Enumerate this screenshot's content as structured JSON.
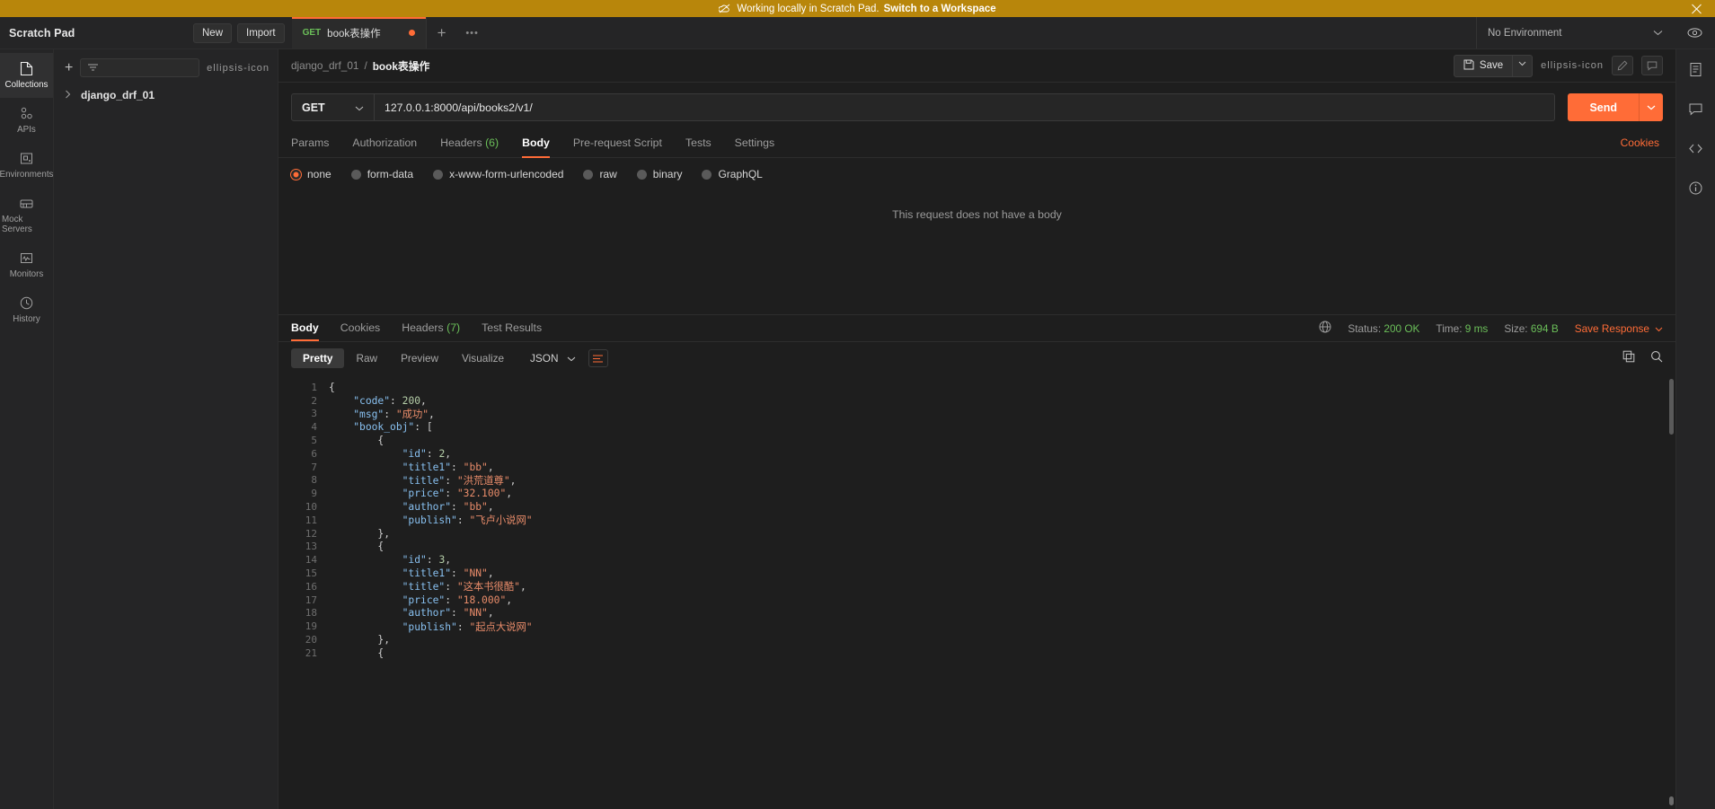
{
  "banner": {
    "icon": "cloud-off-icon",
    "text": "Working locally in Scratch Pad.",
    "link": "Switch to a Workspace",
    "close": "close-icon",
    "bg_color": "#b8860b"
  },
  "header": {
    "brand": "Scratch Pad",
    "new_button": "New",
    "import_button": "Import",
    "tabs": [
      {
        "method": "GET",
        "name": "book表操作",
        "unsaved": true
      }
    ],
    "add_tab": "+",
    "tab_more": "•••",
    "environment": "No Environment",
    "eye_icon": "eye-icon"
  },
  "rail": {
    "items": [
      {
        "label": "Collections",
        "icon": "collections-icon",
        "active": true
      },
      {
        "label": "APIs",
        "icon": "apis-icon",
        "active": false
      },
      {
        "label": "Environments",
        "icon": "environments-icon",
        "active": false
      },
      {
        "label": "Mock Servers",
        "icon": "mock-servers-icon",
        "active": false
      },
      {
        "label": "Monitors",
        "icon": "monitors-icon",
        "active": false
      },
      {
        "label": "History",
        "icon": "history-icon",
        "active": false
      }
    ]
  },
  "sidebar": {
    "add_icon": "plus-icon",
    "filter_icon": "filter-icon",
    "filter_placeholder": "",
    "more_icon": "ellipsis-icon",
    "collections": [
      {
        "name": "django_drf_01",
        "expanded": false
      }
    ]
  },
  "request": {
    "breadcrumb_collection": "django_drf_01",
    "breadcrumb_sep": "/",
    "breadcrumb_current": "book表操作",
    "save_label": "Save",
    "save_caret": "⌄",
    "more_icon": "ellipsis-icon",
    "method": "GET",
    "url": "127.0.0.1:8000/api/books2/v1/",
    "send_label": "Send",
    "tabs": [
      {
        "label": "Params",
        "count": "",
        "active": false
      },
      {
        "label": "Authorization",
        "count": "",
        "active": false
      },
      {
        "label": "Headers",
        "count": "(6)",
        "active": false
      },
      {
        "label": "Body",
        "count": "",
        "active": true
      },
      {
        "label": "Pre-request Script",
        "count": "",
        "active": false
      },
      {
        "label": "Tests",
        "count": "",
        "active": false
      },
      {
        "label": "Settings",
        "count": "",
        "active": false
      }
    ],
    "cookies_link": "Cookies",
    "body_types": [
      {
        "label": "none",
        "selected": true
      },
      {
        "label": "form-data",
        "selected": false
      },
      {
        "label": "x-www-form-urlencoded",
        "selected": false
      },
      {
        "label": "raw",
        "selected": false
      },
      {
        "label": "binary",
        "selected": false
      },
      {
        "label": "GraphQL",
        "selected": false
      }
    ],
    "empty_body_text": "This request does not have a body"
  },
  "response": {
    "tabs": [
      {
        "label": "Body",
        "count": "",
        "active": true
      },
      {
        "label": "Cookies",
        "count": "",
        "active": false
      },
      {
        "label": "Headers",
        "count": "(7)",
        "active": false
      },
      {
        "label": "Test Results",
        "count": "",
        "active": false
      }
    ],
    "globe_icon": "globe-icon",
    "status_label": "Status:",
    "status_value": "200 OK",
    "time_label": "Time:",
    "time_value": "9 ms",
    "size_label": "Size:",
    "size_value": "694 B",
    "save_response": "Save Response",
    "save_response_caret": "⌄",
    "view_modes": [
      {
        "label": "Pretty",
        "active": true
      },
      {
        "label": "Raw",
        "active": false
      },
      {
        "label": "Preview",
        "active": false
      },
      {
        "label": "Visualize",
        "active": false
      }
    ],
    "format": "JSON",
    "format_caret": "⌄",
    "wrap_icon": "wrap-lines-icon",
    "copy_icon": "copy-icon",
    "search_icon": "search-icon",
    "body_lines": [
      {
        "n": 1,
        "tokens": [
          {
            "t": "p",
            "v": "{"
          }
        ]
      },
      {
        "n": 2,
        "tokens": [
          {
            "t": "p",
            "v": "    "
          },
          {
            "t": "k",
            "v": "\"code\""
          },
          {
            "t": "p",
            "v": ": "
          },
          {
            "t": "n",
            "v": "200"
          },
          {
            "t": "p",
            "v": ","
          }
        ]
      },
      {
        "n": 3,
        "tokens": [
          {
            "t": "p",
            "v": "    "
          },
          {
            "t": "k",
            "v": "\"msg\""
          },
          {
            "t": "p",
            "v": ": "
          },
          {
            "t": "s",
            "v": "\"成功\""
          },
          {
            "t": "p",
            "v": ","
          }
        ]
      },
      {
        "n": 4,
        "tokens": [
          {
            "t": "p",
            "v": "    "
          },
          {
            "t": "k",
            "v": "\"book_obj\""
          },
          {
            "t": "p",
            "v": ": ["
          }
        ]
      },
      {
        "n": 5,
        "tokens": [
          {
            "t": "p",
            "v": "        {"
          }
        ]
      },
      {
        "n": 6,
        "tokens": [
          {
            "t": "p",
            "v": "            "
          },
          {
            "t": "k",
            "v": "\"id\""
          },
          {
            "t": "p",
            "v": ": "
          },
          {
            "t": "n",
            "v": "2"
          },
          {
            "t": "p",
            "v": ","
          }
        ]
      },
      {
        "n": 7,
        "tokens": [
          {
            "t": "p",
            "v": "            "
          },
          {
            "t": "k",
            "v": "\"title1\""
          },
          {
            "t": "p",
            "v": ": "
          },
          {
            "t": "s",
            "v": "\"bb\""
          },
          {
            "t": "p",
            "v": ","
          }
        ]
      },
      {
        "n": 8,
        "tokens": [
          {
            "t": "p",
            "v": "            "
          },
          {
            "t": "k",
            "v": "\"title\""
          },
          {
            "t": "p",
            "v": ": "
          },
          {
            "t": "s",
            "v": "\"洪荒道尊\""
          },
          {
            "t": "p",
            "v": ","
          }
        ]
      },
      {
        "n": 9,
        "tokens": [
          {
            "t": "p",
            "v": "            "
          },
          {
            "t": "k",
            "v": "\"price\""
          },
          {
            "t": "p",
            "v": ": "
          },
          {
            "t": "s",
            "v": "\"32.100\""
          },
          {
            "t": "p",
            "v": ","
          }
        ]
      },
      {
        "n": 10,
        "tokens": [
          {
            "t": "p",
            "v": "            "
          },
          {
            "t": "k",
            "v": "\"author\""
          },
          {
            "t": "p",
            "v": ": "
          },
          {
            "t": "s",
            "v": "\"bb\""
          },
          {
            "t": "p",
            "v": ","
          }
        ]
      },
      {
        "n": 11,
        "tokens": [
          {
            "t": "p",
            "v": "            "
          },
          {
            "t": "k",
            "v": "\"publish\""
          },
          {
            "t": "p",
            "v": ": "
          },
          {
            "t": "s",
            "v": "\"飞卢小说网\""
          }
        ]
      },
      {
        "n": 12,
        "tokens": [
          {
            "t": "p",
            "v": "        },"
          }
        ]
      },
      {
        "n": 13,
        "tokens": [
          {
            "t": "p",
            "v": "        {"
          }
        ]
      },
      {
        "n": 14,
        "tokens": [
          {
            "t": "p",
            "v": "            "
          },
          {
            "t": "k",
            "v": "\"id\""
          },
          {
            "t": "p",
            "v": ": "
          },
          {
            "t": "n",
            "v": "3"
          },
          {
            "t": "p",
            "v": ","
          }
        ]
      },
      {
        "n": 15,
        "tokens": [
          {
            "t": "p",
            "v": "            "
          },
          {
            "t": "k",
            "v": "\"title1\""
          },
          {
            "t": "p",
            "v": ": "
          },
          {
            "t": "s",
            "v": "\"NN\""
          },
          {
            "t": "p",
            "v": ","
          }
        ]
      },
      {
        "n": 16,
        "tokens": [
          {
            "t": "p",
            "v": "            "
          },
          {
            "t": "k",
            "v": "\"title\""
          },
          {
            "t": "p",
            "v": ": "
          },
          {
            "t": "s",
            "v": "\"这本书很酷\""
          },
          {
            "t": "p",
            "v": ","
          }
        ]
      },
      {
        "n": 17,
        "tokens": [
          {
            "t": "p",
            "v": "            "
          },
          {
            "t": "k",
            "v": "\"price\""
          },
          {
            "t": "p",
            "v": ": "
          },
          {
            "t": "s",
            "v": "\"18.000\""
          },
          {
            "t": "p",
            "v": ","
          }
        ]
      },
      {
        "n": 18,
        "tokens": [
          {
            "t": "p",
            "v": "            "
          },
          {
            "t": "k",
            "v": "\"author\""
          },
          {
            "t": "p",
            "v": ": "
          },
          {
            "t": "s",
            "v": "\"NN\""
          },
          {
            "t": "p",
            "v": ","
          }
        ]
      },
      {
        "n": 19,
        "tokens": [
          {
            "t": "p",
            "v": "            "
          },
          {
            "t": "k",
            "v": "\"publish\""
          },
          {
            "t": "p",
            "v": ": "
          },
          {
            "t": "s",
            "v": "\"起点大说网\""
          }
        ]
      },
      {
        "n": 20,
        "tokens": [
          {
            "t": "p",
            "v": "        },"
          }
        ]
      },
      {
        "n": 21,
        "tokens": [
          {
            "t": "p",
            "v": "        {"
          }
        ]
      }
    ]
  },
  "right_rail": {
    "items": [
      {
        "icon": "document-icon"
      },
      {
        "icon": "comment-icon"
      },
      {
        "icon": "code-icon"
      },
      {
        "icon": "info-icon"
      }
    ]
  },
  "colors": {
    "accent": "#ff6c37",
    "success": "#6bbf59",
    "banner": "#b8860b",
    "bg": "#1e1e1e",
    "panel": "#252526"
  }
}
